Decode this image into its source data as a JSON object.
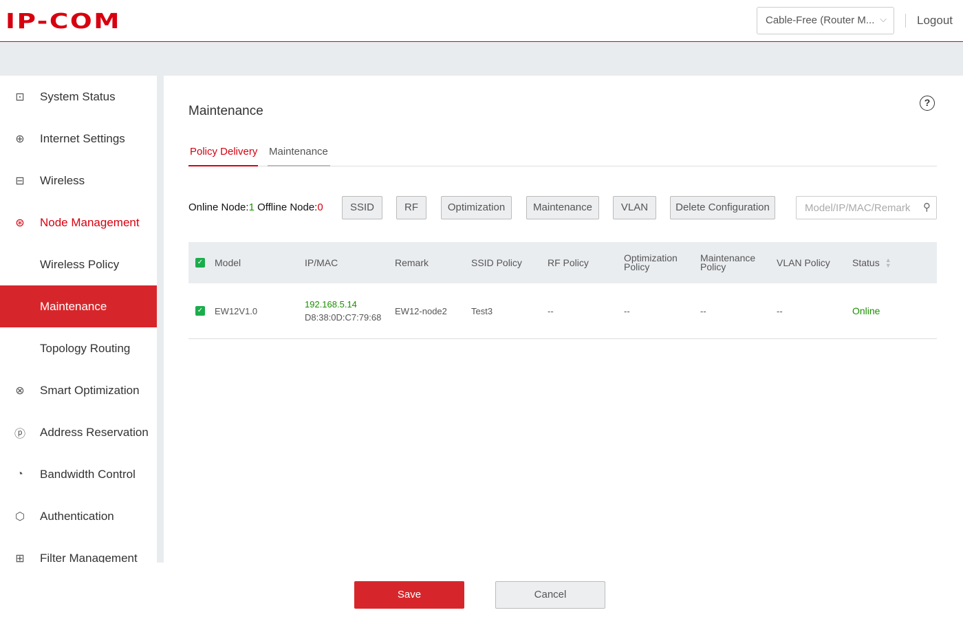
{
  "header": {
    "logo": "IP-COM",
    "mode": "Cable-Free (Router M...",
    "logout": "Logout"
  },
  "sidebar": {
    "items": [
      {
        "label": "System Status",
        "icon": "monitor-icon",
        "glyph": "⊡"
      },
      {
        "label": "Internet Settings",
        "icon": "globe-icon",
        "glyph": "⊕"
      },
      {
        "label": "Wireless",
        "icon": "wifi-screen-icon",
        "glyph": "⊟"
      },
      {
        "label": "Node Management",
        "icon": "node-icon",
        "glyph": "⊛"
      },
      {
        "label": "Wireless Policy",
        "icon": "",
        "glyph": ""
      },
      {
        "label": "Maintenance",
        "icon": "",
        "glyph": ""
      },
      {
        "label": "Topology Routing",
        "icon": "",
        "glyph": ""
      },
      {
        "label": "Smart Optimization",
        "icon": "atom-icon",
        "glyph": "⊗"
      },
      {
        "label": "Address Reservation",
        "icon": "ip-icon",
        "glyph": "ⓟ"
      },
      {
        "label": "Bandwidth Control",
        "icon": "gauge-icon",
        "glyph": "◔"
      },
      {
        "label": "Authentication",
        "icon": "shield-icon",
        "glyph": "⬡"
      },
      {
        "label": "Filter Management",
        "icon": "filter-icon",
        "glyph": "⊞"
      }
    ]
  },
  "main": {
    "title": "Maintenance",
    "tabs": [
      "Policy Delivery",
      "Maintenance"
    ],
    "online_label": "Online Node:",
    "online_count": "1",
    "offline_label": " Offline Node:",
    "offline_count": "0",
    "buttons": [
      "SSID",
      "RF",
      "Optimization",
      "Maintenance",
      "VLAN",
      "Delete Configuration"
    ],
    "search_placeholder": "Model/IP/MAC/Remark",
    "columns": [
      "Model",
      "IP/MAC",
      "Remark",
      "SSID Policy",
      "RF Policy",
      "Optimization Policy",
      "Maintenance Policy",
      "VLAN Policy",
      "Status"
    ],
    "rows": [
      {
        "model": "EW12V1.0",
        "ip": "192.168.5.14",
        "mac": "D8:38:0D:C7:79:68",
        "remark": "EW12-node2",
        "ssid": "Test3",
        "rf": "--",
        "opt": "--",
        "maint": "--",
        "vlan": "--",
        "status": "Online",
        "checked": true
      }
    ]
  },
  "footer": {
    "save": "Save",
    "cancel": "Cancel"
  },
  "colors": {
    "brand": "#d7000f",
    "online": "#1a8f00",
    "checkbox": "#1aad4c"
  }
}
